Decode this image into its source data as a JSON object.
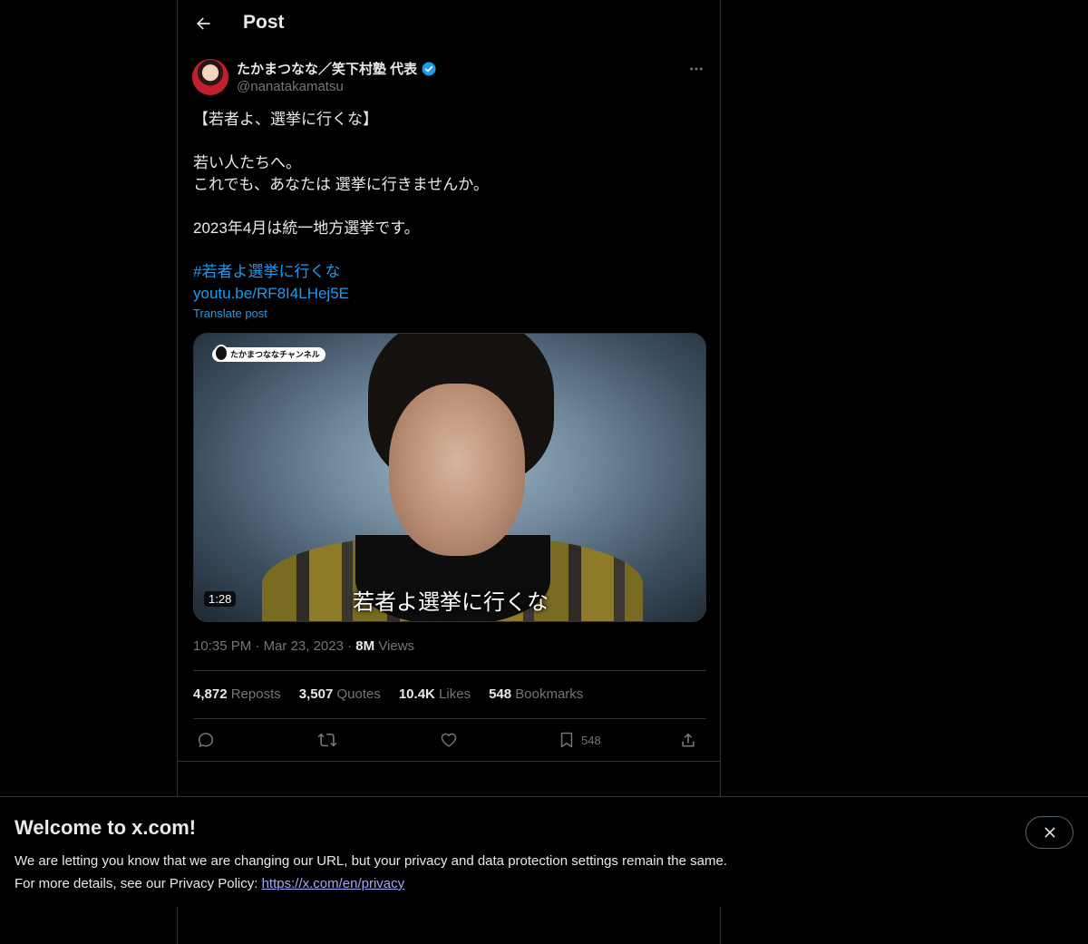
{
  "header": {
    "title": "Post"
  },
  "author": {
    "display_name": "たかまつなな／笑下村塾 代表",
    "handle": "@nanatakamatsu"
  },
  "post": {
    "lines": [
      "【若者よ、選挙に行くな】",
      "",
      "若い人たちへ。",
      "これでも、あなたは 選挙に行きませんか。",
      "",
      "2023年4月は統一地方選挙です。",
      ""
    ],
    "hashtag": "#若者よ選挙に行くな",
    "link": "youtu.be/RF8I4LHej5E",
    "translate_label": "Translate post"
  },
  "media": {
    "channel_badge": "たかまつななチャンネル",
    "subtitle": "若者よ選挙に行くな",
    "duration": "1:28"
  },
  "meta": {
    "time": "10:35 PM",
    "date": "Mar 23, 2023",
    "views_count": "8M",
    "views_label": "Views"
  },
  "stats": {
    "reposts_count": "4,872",
    "reposts_label": "Reposts",
    "quotes_count": "3,507",
    "quotes_label": "Quotes",
    "likes_count": "10.4K",
    "likes_label": "Likes",
    "bookmarks_count": "548",
    "bookmarks_label": "Bookmarks"
  },
  "actions": {
    "bookmark_count": "548"
  },
  "banner": {
    "title": "Welcome to x.com!",
    "line1": "We are letting you know that we are changing our URL, but your privacy and data protection settings remain the same.",
    "line2_prefix": "For more details, see our Privacy Policy: ",
    "link": "https://x.com/en/privacy"
  },
  "colors": {
    "accent": "#1d9bf0",
    "muted": "#71767b",
    "border": "#2f3336",
    "background": "#000000"
  }
}
